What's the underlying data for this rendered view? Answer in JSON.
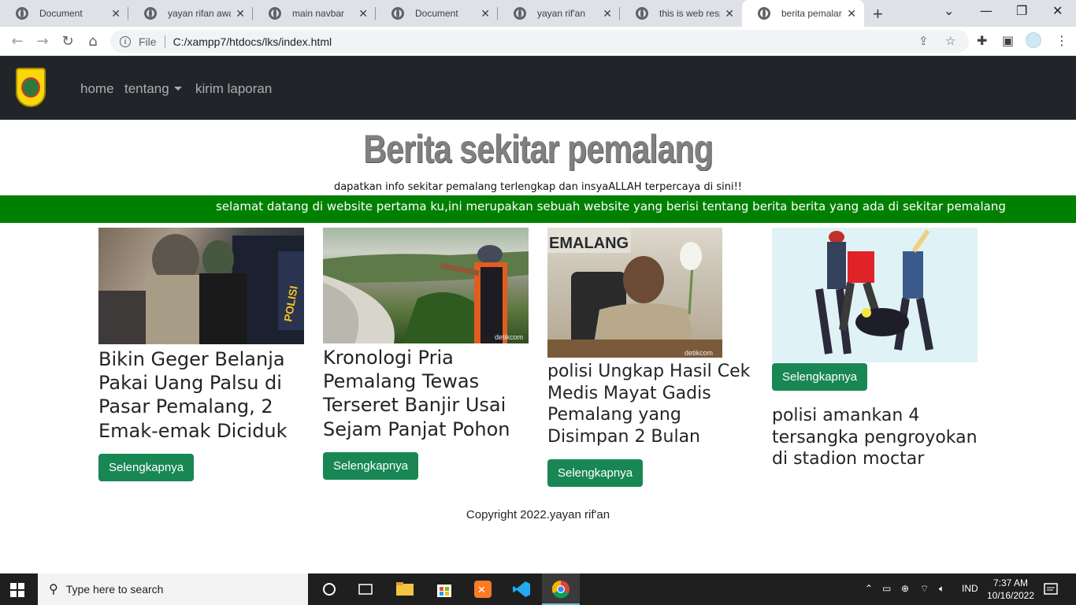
{
  "browser": {
    "tabs": [
      {
        "label": "Document"
      },
      {
        "label": "yayan rifan awalu"
      },
      {
        "label": "main navbar"
      },
      {
        "label": "Document"
      },
      {
        "label": "yayan rif'an"
      },
      {
        "label": "this is web respo"
      },
      {
        "label": "berita pemalang"
      }
    ],
    "new_tab": "+",
    "address_scheme": "File",
    "address_url": "C:/xampp7/htdocs/lks/index.html"
  },
  "navbar": {
    "links": [
      "home",
      "tentang",
      "kirim laporan"
    ]
  },
  "hero": {
    "title": "Berita sekitar pemalang",
    "subtitle": "dapatkan info sekitar pemalang terlengkap dan insyaALLAH terpercaya di sini!!",
    "marquee": "selamat datang di website pertama ku,ini merupakan sebuah website yang berisi tentang berita berita yang ada di sekitar pemalang"
  },
  "cards": [
    {
      "title": "Bikin Geger Belanja Pakai Uang Palsu di Pasar Pemalang, 2 Emak-emak Diciduk",
      "button": "Selengkapnya"
    },
    {
      "title": "Kronologi Pria Pemalang Tewas Terseret Banjir Usai Sejam Panjat Pohon",
      "button": "Selengkapnya"
    },
    {
      "title": "polisi Ungkap Hasil Cek Medis Mayat Gadis Pemalang yang Disimpan 2 Bulan",
      "button": "Selengkapnya",
      "image_text": "EMALANG",
      "watermark": "detikcom"
    },
    {
      "title": "polisi amankan 4 tersangka pengroyokan di stadion moctar",
      "button": "Selengkapnya"
    }
  ],
  "image_watermark": "detikcom",
  "footer": {
    "text": "Copyright 2022.yayan rif'an"
  },
  "taskbar": {
    "search_placeholder": "Type here to search",
    "language": "IND",
    "time": "7:37 AM",
    "date": "10/16/2022"
  },
  "colors": {
    "navbar_bg": "#212529",
    "marquee_bg": "#008000",
    "button_bg": "#198754",
    "title_color": "#808080"
  }
}
